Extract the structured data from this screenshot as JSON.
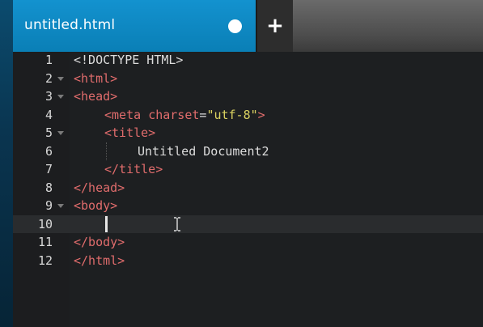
{
  "tab": {
    "title": "untitled.html",
    "new_tab_label": "+"
  },
  "colors": {
    "tab_active": "#0a86c2",
    "tag": "#e06c6c",
    "string": "#d8d060",
    "text": "#dcdcdc",
    "background": "#1d1f21"
  },
  "gutter": {
    "line_numbers": [
      "1",
      "2",
      "3",
      "4",
      "5",
      "6",
      "7",
      "8",
      "9",
      "10",
      "11",
      "12"
    ],
    "foldable_lines": [
      2,
      3,
      5,
      9
    ],
    "active_line": 10
  },
  "code": {
    "line1": "<!DOCTYPE HTML>",
    "line2": "<html>",
    "line3": "<head>",
    "line4_open": "<meta ",
    "line4_attr": "charset",
    "line4_eq": "=",
    "line4_val": "\"utf-8\"",
    "line4_close": ">",
    "line5": "<title>",
    "line6": "Untitled Document2",
    "line7": "</title>",
    "line8": "</head>",
    "line9": "<body>",
    "line10": "",
    "line11": "</body>",
    "line12": "</html>"
  },
  "icons": {
    "unsaved": "unsaved-dot-icon",
    "fold": "fold-triangle-icon",
    "cursor": "ibeam-cursor-icon"
  }
}
